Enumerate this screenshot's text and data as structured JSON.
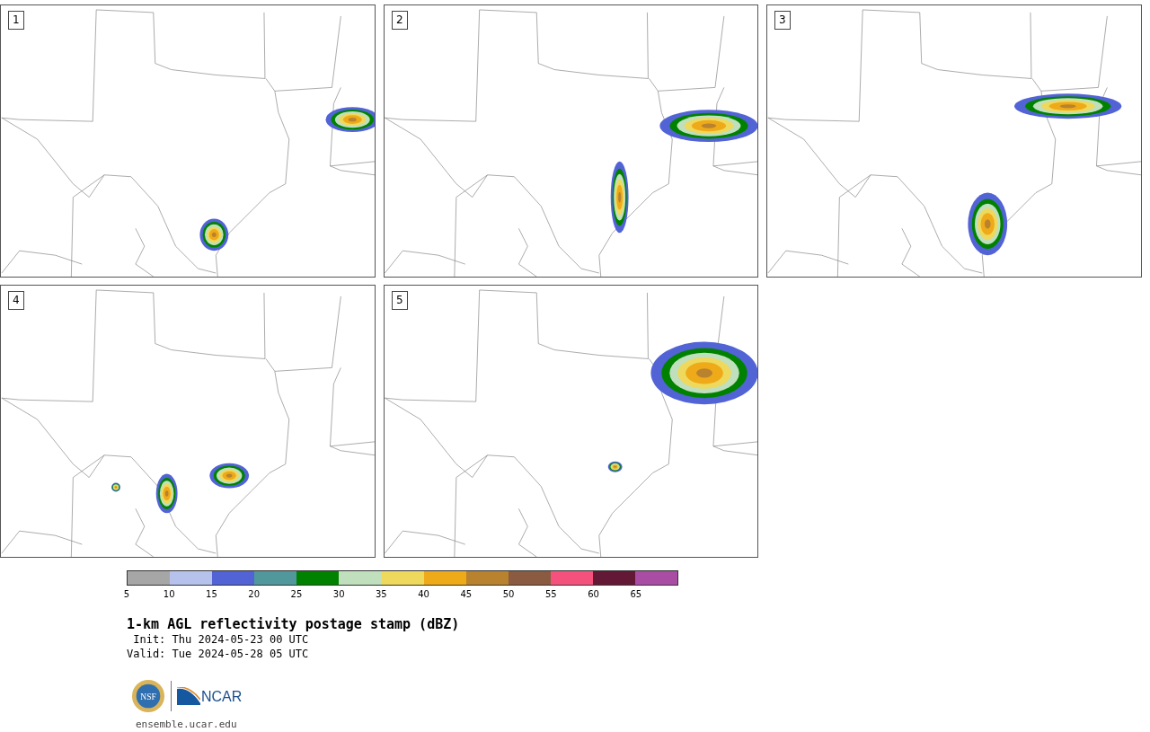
{
  "panels": [
    {
      "label": "1"
    },
    {
      "label": "2"
    },
    {
      "label": "3"
    },
    {
      "label": "4"
    },
    {
      "label": "5"
    }
  ],
  "colorbar": {
    "segments": [
      {
        "color": "#a6a6a6"
      },
      {
        "color": "#b6c2ec"
      },
      {
        "color": "#5263d6"
      },
      {
        "color": "#51989c"
      },
      {
        "color": "#008200"
      },
      {
        "color": "#bfdfbd"
      },
      {
        "color": "#eed95c"
      },
      {
        "color": "#eeaa19"
      },
      {
        "color": "#b8822f"
      },
      {
        "color": "#8a5b40"
      },
      {
        "color": "#f4527c"
      },
      {
        "color": "#631936"
      },
      {
        "color": "#a94ca4"
      }
    ],
    "ticks": [
      "5",
      "10",
      "15",
      "20",
      "25",
      "30",
      "35",
      "40",
      "45",
      "50",
      "55",
      "60",
      "65"
    ]
  },
  "title": "1-km AGL reflectivity postage stamp (dBZ)",
  "init": " Init: Thu 2024-05-23 00 UTC",
  "valid": "Valid: Tue 2024-05-28 05 UTC",
  "logos": {
    "seal_text": "NSF",
    "wordmark": "NCAR"
  },
  "url": "ensemble.ucar.edu"
}
